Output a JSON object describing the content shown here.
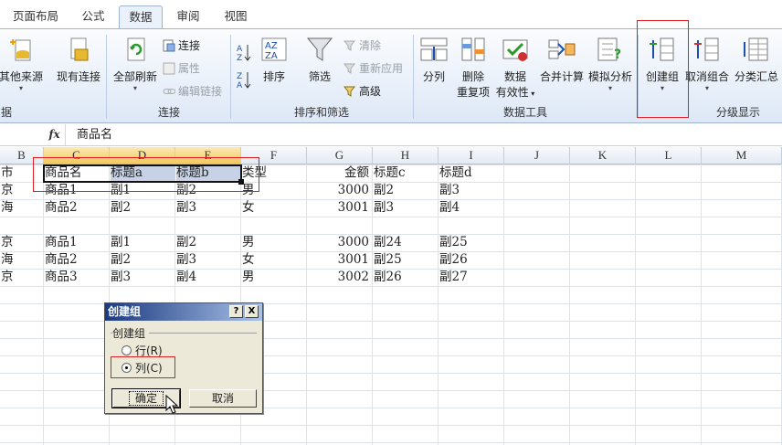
{
  "tabs": [
    "页面布局",
    "公式",
    "数据",
    "审阅",
    "视图"
  ],
  "ribbon": {
    "groups": {
      "external": "据",
      "connections": "连接",
      "sort_filter": "排序和筛选",
      "data_tools": "数据工具",
      "outline": "分级显示"
    },
    "other_sources": "其他来源",
    "existing_conn": "现有连接",
    "refresh_all": "全部刷新",
    "connections": "连接",
    "properties": "属性",
    "edit_links": "编辑链接",
    "sort": "排序",
    "filter": "筛选",
    "clear": "清除",
    "reapply": "重新应用",
    "advanced": "高级",
    "text_to_cols": "分列",
    "remove_dup_1": "删除",
    "remove_dup_2": "重复项",
    "validation_1": "数据",
    "validation_2": "有效性",
    "consolidate": "合并计算",
    "whatif": "模拟分析",
    "group": "创建组",
    "ungroup": "取消组合",
    "subtotal": "分类汇总"
  },
  "formula_bar": {
    "fx": "fx",
    "value": "商品名"
  },
  "columns": [
    "B",
    "C",
    "D",
    "E",
    "F",
    "G",
    "H",
    "I",
    "J",
    "K",
    "L",
    "M"
  ],
  "rows": [
    [
      "市",
      "商品名",
      "标题a",
      "标题b",
      "类型",
      "金额",
      "标题c",
      "标题d"
    ],
    [
      "京",
      "商品1",
      "副1",
      "副2",
      "男",
      "3000",
      "副2",
      "副3"
    ],
    [
      "海",
      "商品2",
      "副2",
      "副3",
      "女",
      "3001",
      "副3",
      "副4"
    ],
    [
      "",
      "",
      "",
      "",
      "",
      "",
      "",
      ""
    ],
    [
      "京",
      "商品1",
      "副1",
      "副2",
      "男",
      "3000",
      "副24",
      "副25"
    ],
    [
      "海",
      "商品2",
      "副2",
      "副3",
      "女",
      "3001",
      "副25",
      "副26"
    ],
    [
      "京",
      "商品3",
      "副3",
      "副4",
      "男",
      "3002",
      "副26",
      "副27"
    ]
  ],
  "dialog": {
    "title": "创建组",
    "help": "?",
    "close": "X",
    "group_label": "创建组",
    "row_option": "行(R)",
    "col_option": "列(C)",
    "ok": "确定",
    "cancel": "取消"
  }
}
